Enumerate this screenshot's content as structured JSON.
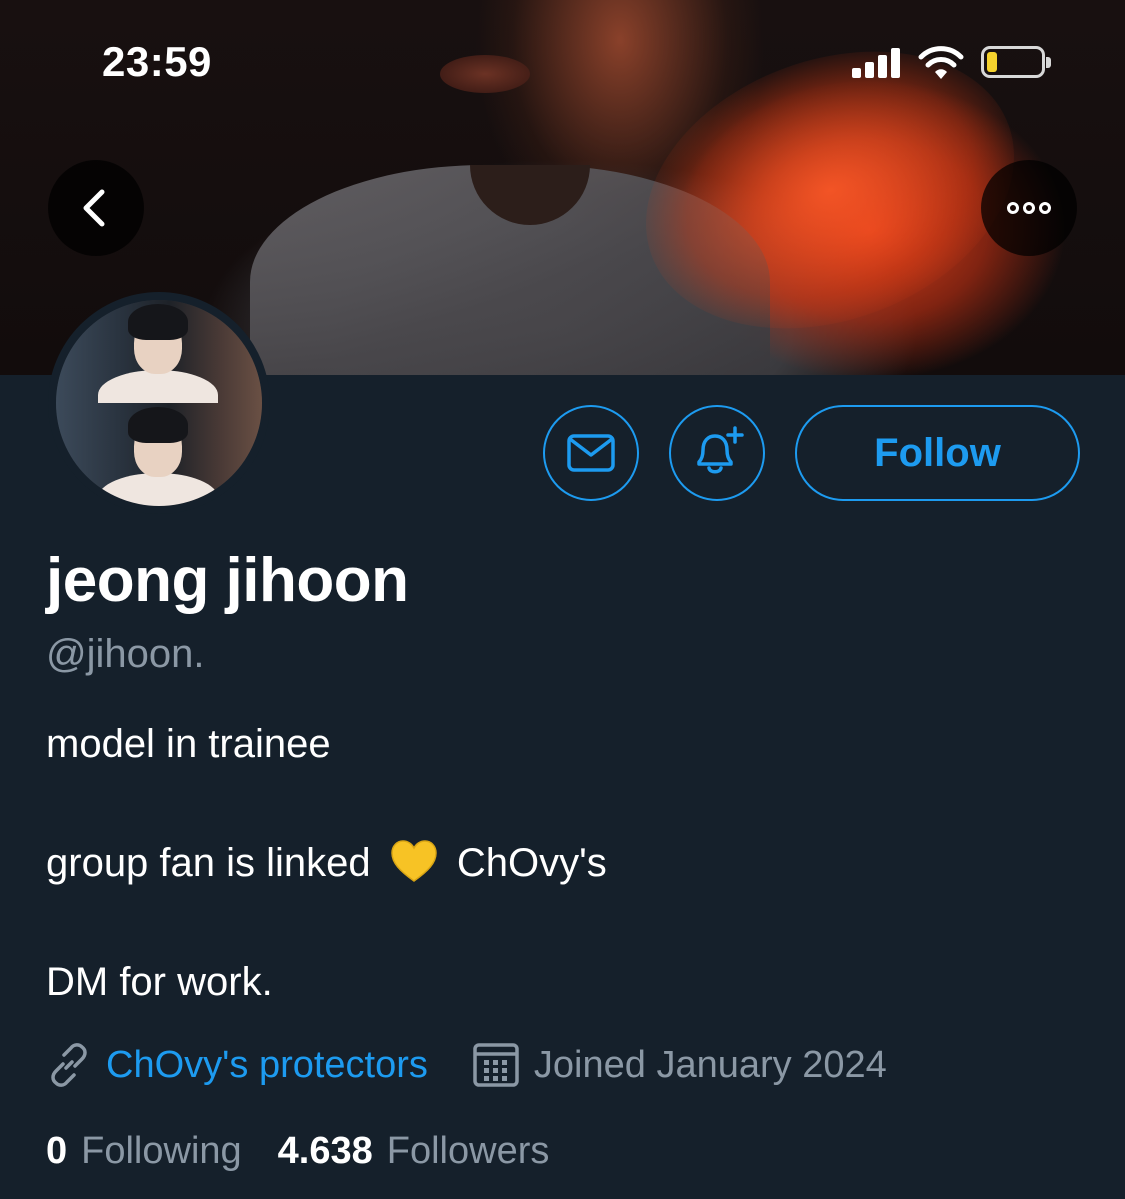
{
  "status_bar": {
    "time": "23:59"
  },
  "profile": {
    "display_name": "jeong jihoon",
    "handle": "@jihoon.",
    "bio": {
      "line1": "model in trainee",
      "line2_before": "group fan is linked",
      "line2_emoji": "yellow-heart",
      "line2_after": "ChOvy's",
      "line3": "DM for work."
    },
    "link_text": "ChOvy's protectors",
    "joined_text": "Joined January 2024",
    "following_count": "0",
    "following_label": "Following",
    "followers_count": "4.638",
    "followers_label": "Followers"
  },
  "actions": {
    "follow_label": "Follow",
    "message_icon": "mail-icon",
    "notify_icon": "bell-plus-icon",
    "back_icon": "chevron-left-icon",
    "more_icon": "more-horizontal-icon"
  },
  "colors": {
    "background": "#15202b",
    "accent": "#1d9bf0",
    "secondary_text": "#8b98a5",
    "battery": "#f5d22d"
  }
}
